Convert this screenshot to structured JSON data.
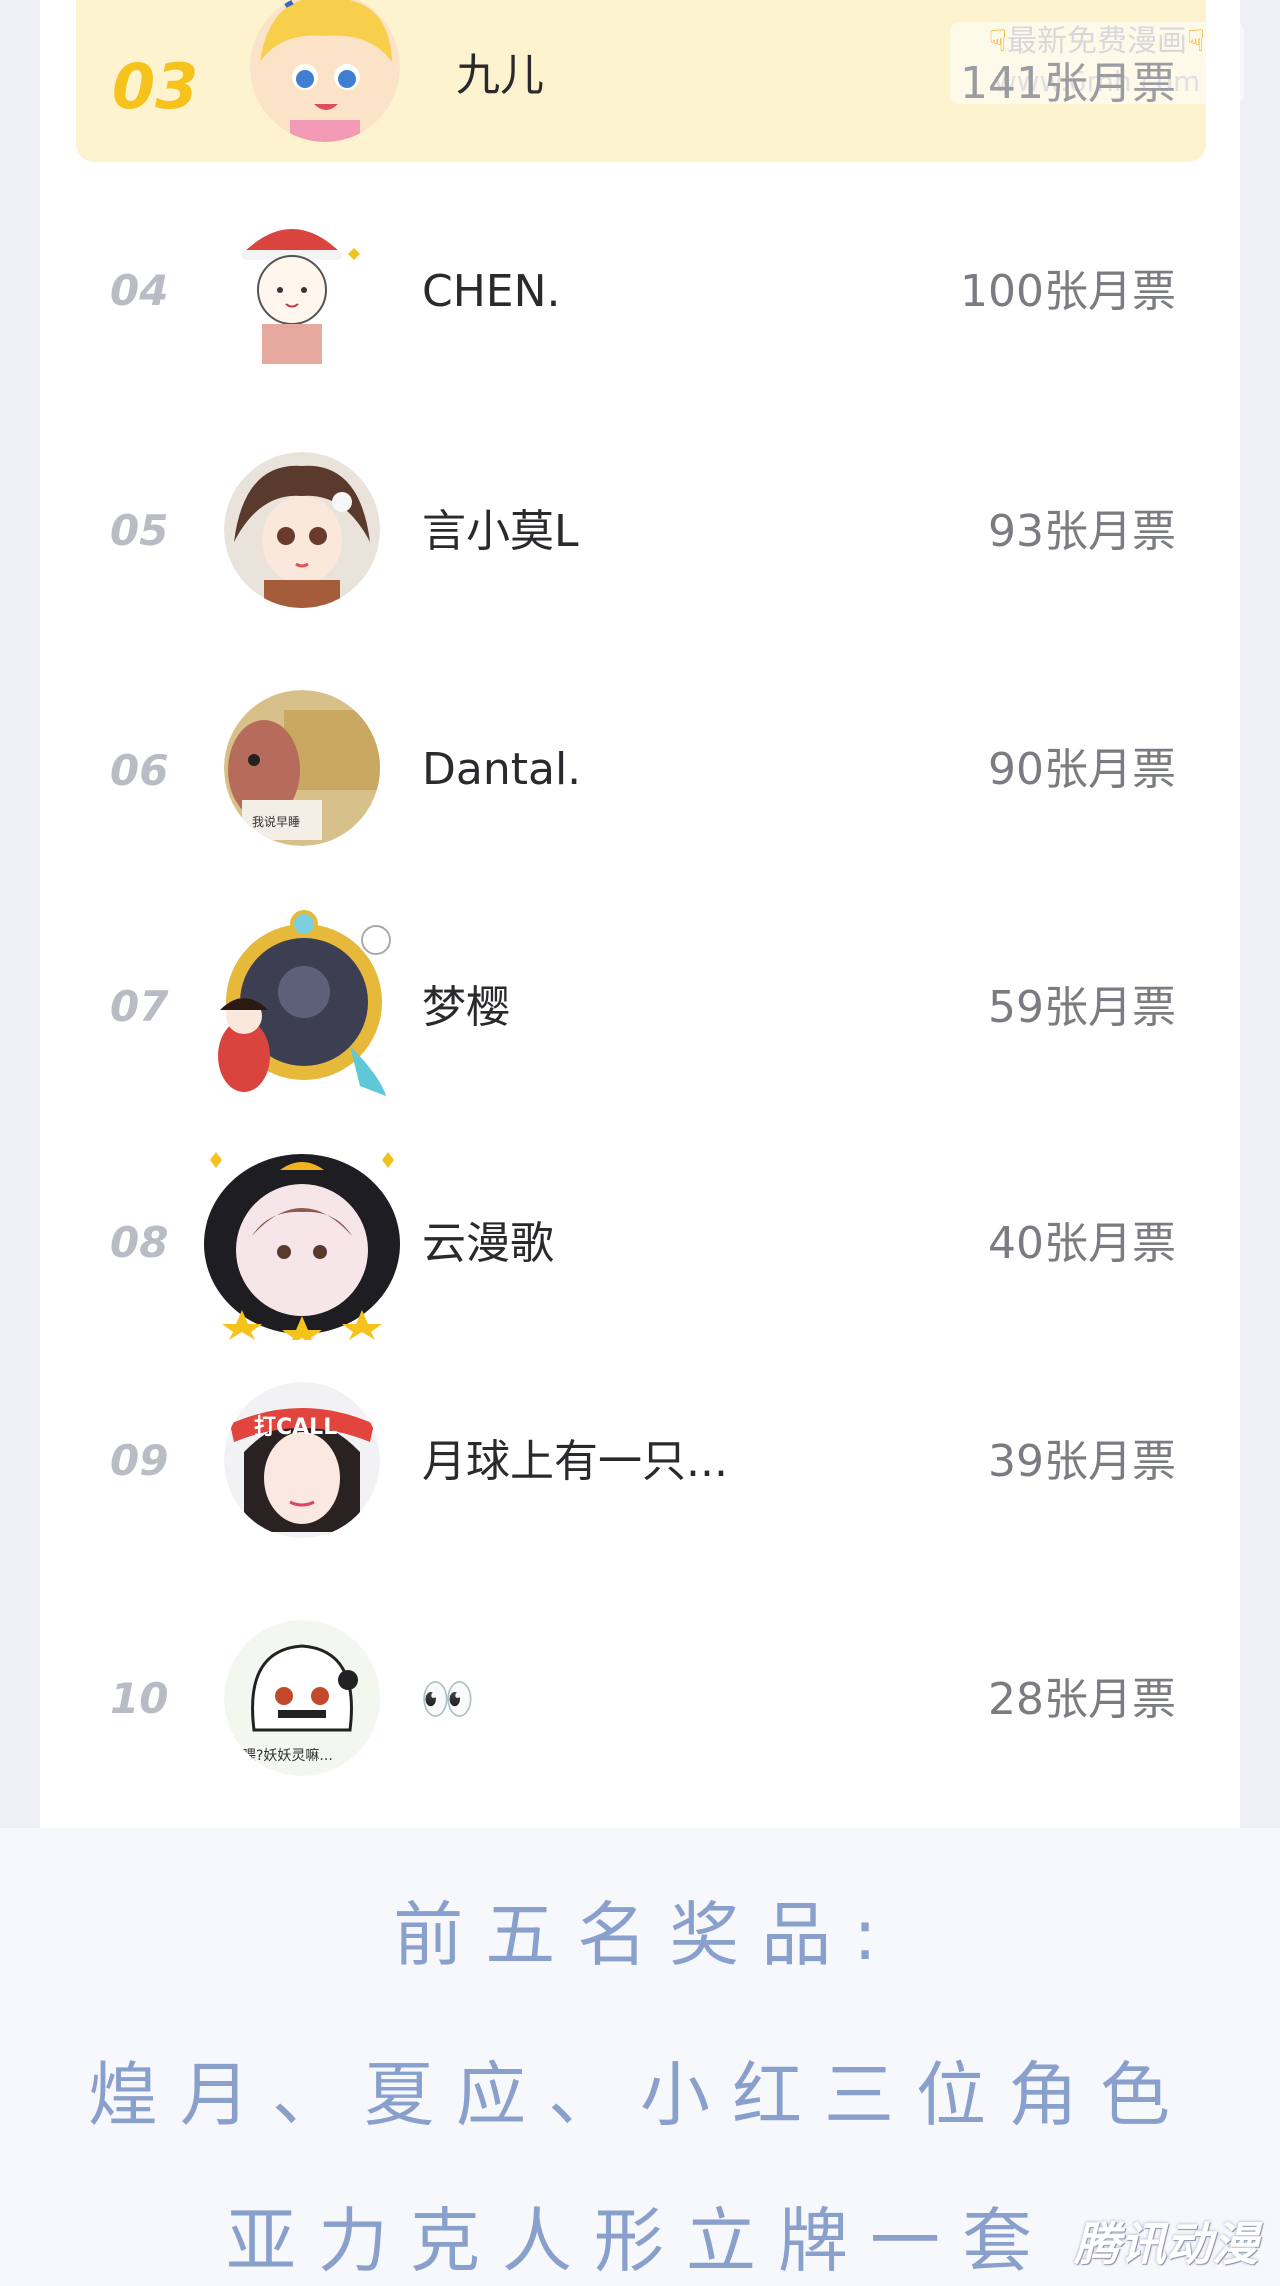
{
  "ranking": [
    {
      "rank": "03",
      "name": "九儿",
      "votes": "141张月票",
      "avatar": "blonde-chibi-avatar",
      "highlight": true
    },
    {
      "rank": "04",
      "name": "CHEN.",
      "votes": "100张月票",
      "avatar": "santa-hat-chibi-avatar"
    },
    {
      "rank": "05",
      "name": "言小莫L",
      "votes": "93张月票",
      "avatar": "ancient-girl-avatar"
    },
    {
      "rank": "06",
      "name": "Dantal.",
      "votes": "90张月票",
      "avatar": "meme-dog-avatar",
      "avatar_caption": "我说早睡"
    },
    {
      "rank": "07",
      "name": "梦樱",
      "votes": "59张月票",
      "avatar": "framed-dark-avatar"
    },
    {
      "rank": "08",
      "name": "云漫歌",
      "votes": "40张月票",
      "avatar": "penguin-frame-avatar"
    },
    {
      "rank": "09",
      "name": "月球上有一只...",
      "votes": "39张月票",
      "avatar": "call-girl-avatar",
      "avatar_caption": "打CALL"
    },
    {
      "rank": "10",
      "name": "👀",
      "votes": "28张月票",
      "avatar": "sketch-ghost-avatar",
      "avatar_caption": "喂?妖妖灵嘛..."
    }
  ],
  "prizes": {
    "line1": "前五名奖品:",
    "line2": "煌月、夏应、小红三位角色",
    "line3": "亚力克人形立牌一套"
  },
  "watermark": {
    "line1": "最新免费漫画",
    "line2": "www.6mh.com",
    "logo": "腾讯动漫"
  },
  "colors": {
    "highlight_bg": "#fdf3cf",
    "gold_rank": "#f6c21c",
    "prize_text": "#8aa0cc"
  }
}
